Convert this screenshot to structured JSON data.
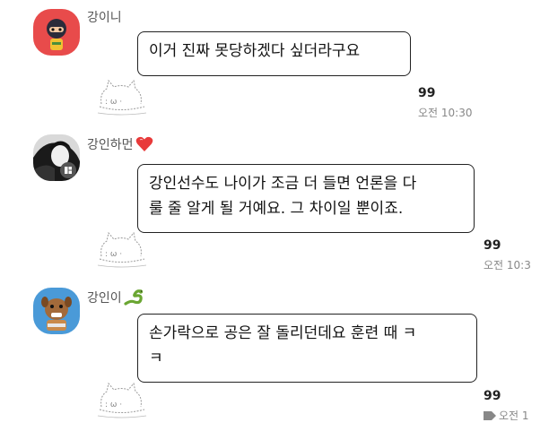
{
  "messages": [
    {
      "sender": "강이니",
      "text": "이거 진짜 못당하겠다 싶더라구요",
      "count": "99",
      "time": "오전 10:30"
    },
    {
      "sender": "강인하먼",
      "sender_emoji": "❤️",
      "text_line1": "강인선수도 나이가 조금 더 들면 언론을 다",
      "text_line2": "룰 줄 알게 될 거예요. 그 차이일 뿐이죠.",
      "count": "99",
      "time": "오전 10:3"
    },
    {
      "sender": "강인이",
      "sender_emoji": "🐍",
      "text_line1": "손가락으로 공은 잘 돌리던데요 훈련 때 ㅋ",
      "text_line2": "ㅋ",
      "count": "99",
      "time": "오전 1"
    }
  ],
  "colors": {
    "avatar1_bg": "#e84b4b",
    "heart": "#e83a3a",
    "avatar3_bg": "#4a9ad8"
  },
  "icons": {
    "sticker": "cat-doodle-icon",
    "heart": "heart-icon",
    "snake": "snake-icon",
    "tag": "tag-icon",
    "badge": "profile-badge-icon"
  }
}
